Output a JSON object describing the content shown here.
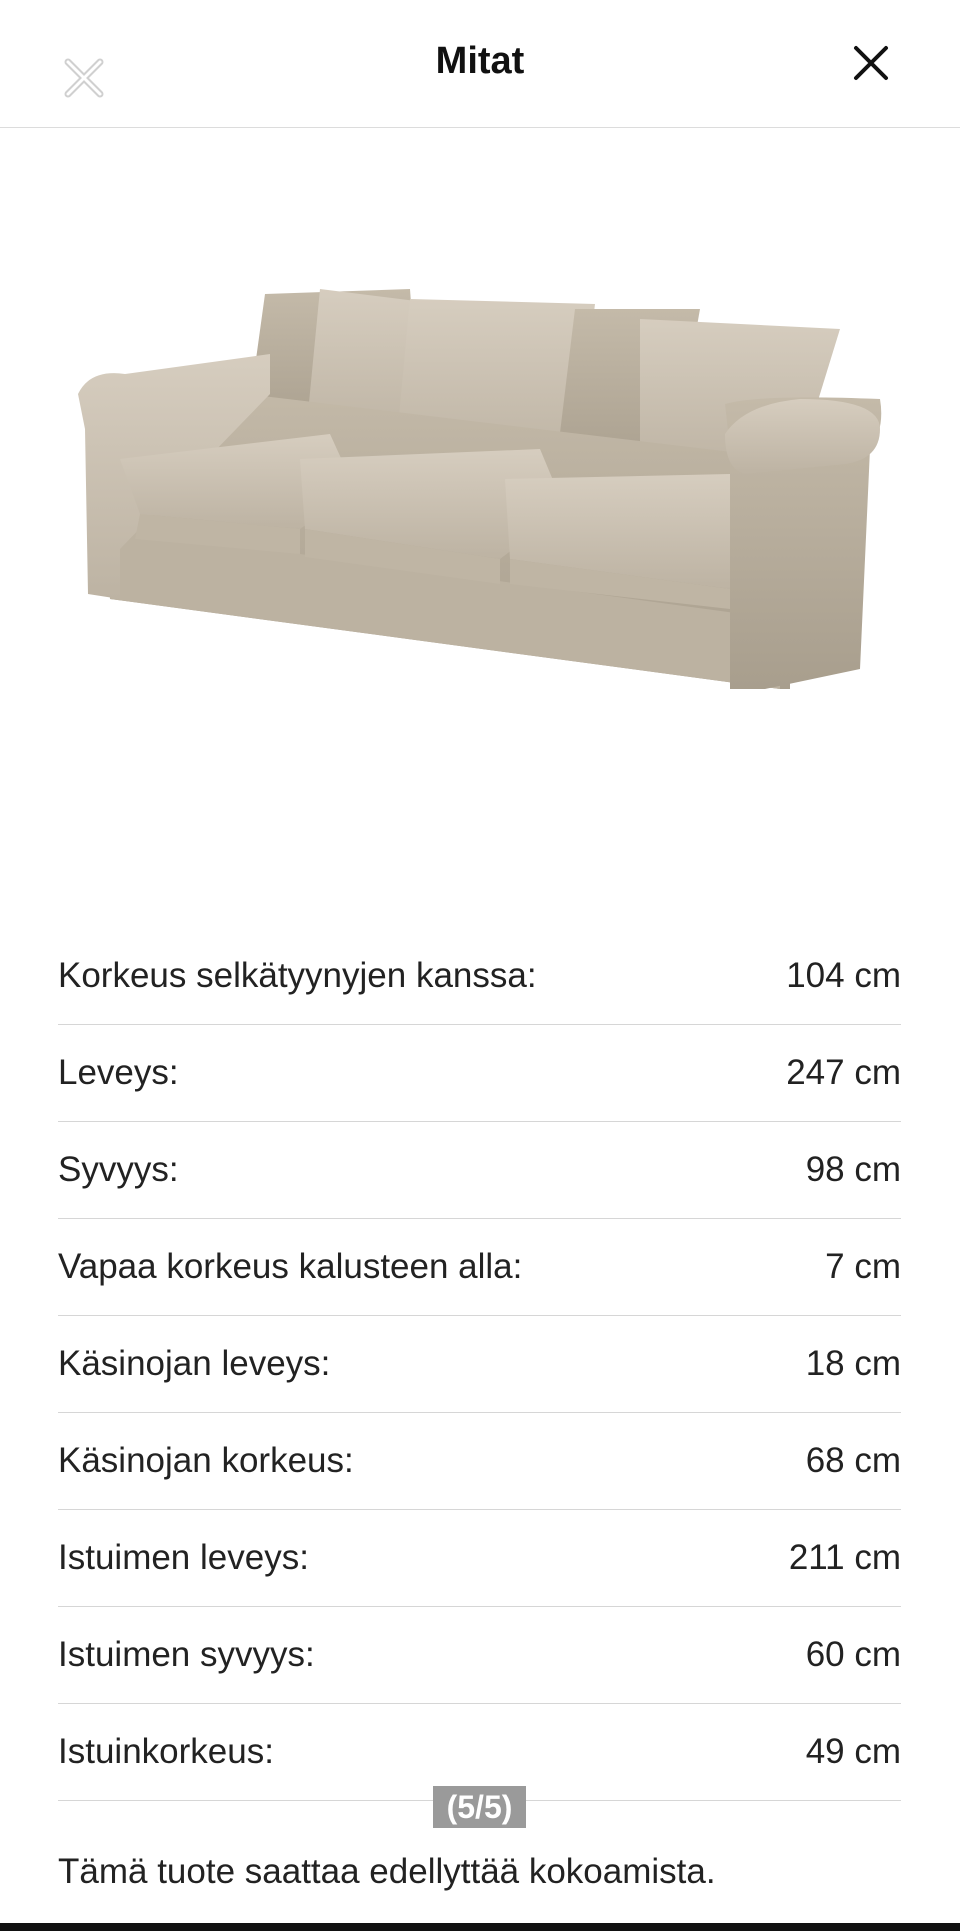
{
  "header": {
    "title": "Mitat",
    "close_icon": "close-icon",
    "ghost_icon": "close-icon"
  },
  "product_image": {
    "subject": "sofa",
    "color": "#c8bfb0"
  },
  "dimensions": [
    {
      "label": "Korkeus selkätyynyjen kanssa:",
      "value": "104 cm"
    },
    {
      "label": "Leveys:",
      "value": "247 cm"
    },
    {
      "label": "Syvyys:",
      "value": "98 cm"
    },
    {
      "label": "Vapaa korkeus kalusteen alla:",
      "value": "7 cm"
    },
    {
      "label": "Käsinojan leveys:",
      "value": "18 cm"
    },
    {
      "label": "Käsinojan korkeus:",
      "value": "68 cm"
    },
    {
      "label": "Istuimen leveys:",
      "value": "211 cm"
    },
    {
      "label": "Istuimen syvyys:",
      "value": "60 cm"
    },
    {
      "label": "Istuinkorkeus:",
      "value": "49 cm"
    }
  ],
  "note": "Tämä tuote saattaa edellyttää kokoamista.",
  "pager": "(5/5)"
}
